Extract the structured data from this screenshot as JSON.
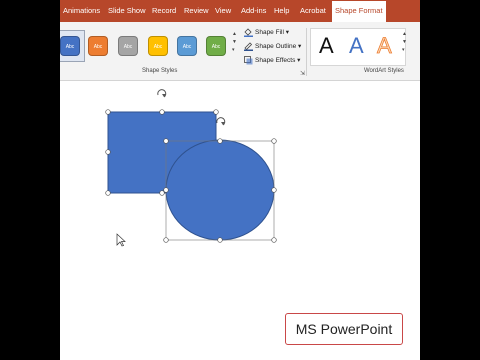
{
  "menu": {
    "items": [
      "Animations",
      "Slide Show",
      "Record",
      "Review",
      "View",
      "Add-ins",
      "Help",
      "Acrobat"
    ],
    "active": "Shape Format"
  },
  "shape_styles": {
    "label": "Shape Styles",
    "button_text": "Abc",
    "colors": [
      "#4472c4",
      "#ed7d31",
      "#a5a5a5",
      "#ffc000",
      "#5b9bd5",
      "#70ad47"
    ],
    "fill": "Shape Fill",
    "outline": "Shape Outline",
    "effects": "Shape Effects"
  },
  "wordart": {
    "label": "WordArt Styles",
    "letter": "A"
  },
  "shapes": {
    "rect_color": "#4472c4",
    "circle_color": "#4472c4",
    "outline": "#2f528f"
  },
  "badge": {
    "text": "MS PowerPoint"
  }
}
